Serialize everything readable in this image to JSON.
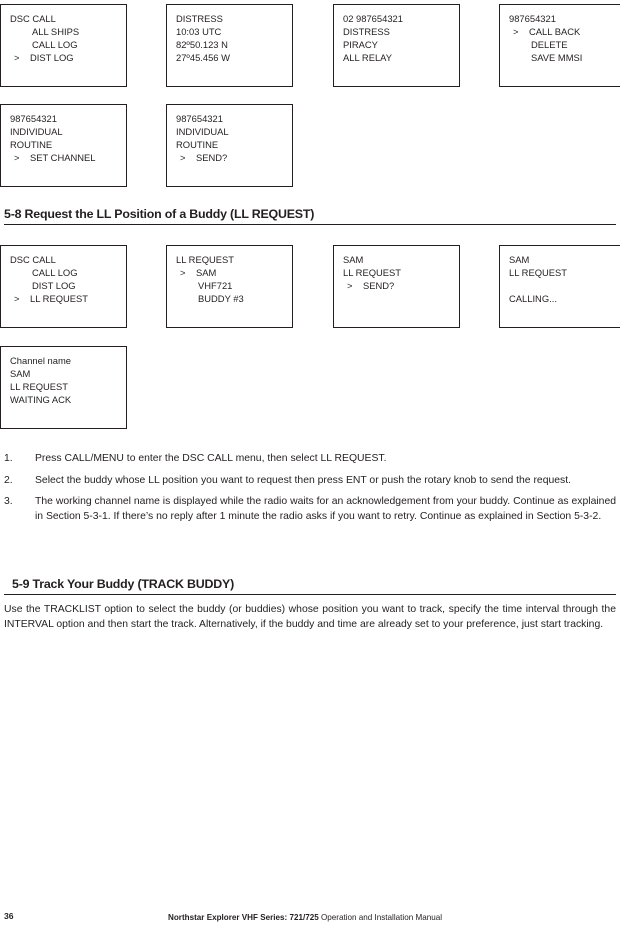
{
  "screens": {
    "row1": [
      {
        "name": "screen-dsc-call-dist-log",
        "lines": [
          {
            "text": "DSC CALL",
            "style": "plain"
          },
          {
            "text": "ALL SHIPS",
            "style": "indent"
          },
          {
            "text": "CALL LOG",
            "style": "indent"
          },
          {
            "text": "DIST LOG",
            "style": "selected"
          }
        ]
      },
      {
        "name": "screen-distress-position",
        "lines": [
          {
            "text": "DISTRESS",
            "style": "plain"
          },
          {
            "text": "10:03 UTC",
            "style": "plain"
          },
          {
            "text": "82º50.123 N",
            "style": "plain"
          },
          {
            "text": "27º45.456 W",
            "style": "plain"
          }
        ]
      },
      {
        "name": "screen-distress-piracy-relay",
        "lines": [
          {
            "text": "02 987654321",
            "style": "plain"
          },
          {
            "text": "DISTRESS",
            "style": "plain"
          },
          {
            "text": "PIRACY",
            "style": "plain"
          },
          {
            "text": "ALL RELAY",
            "style": "plain"
          }
        ]
      },
      {
        "name": "screen-mmsi-options",
        "lines": [
          {
            "text": "987654321",
            "style": "plain"
          },
          {
            "text": "CALL BACK",
            "style": "selected"
          },
          {
            "text": "DELETE",
            "style": "indent"
          },
          {
            "text": "SAVE MMSI",
            "style": "indent"
          }
        ]
      }
    ],
    "row2": [
      {
        "name": "screen-individual-set-channel",
        "lines": [
          {
            "text": "987654321",
            "style": "plain"
          },
          {
            "text": "INDIVIDUAL",
            "style": "plain"
          },
          {
            "text": "ROUTINE",
            "style": "plain"
          },
          {
            "text": "SET CHANNEL",
            "style": "selected"
          }
        ]
      },
      {
        "name": "screen-individual-send",
        "lines": [
          {
            "text": "987654321",
            "style": "plain"
          },
          {
            "text": "INDIVIDUAL",
            "style": "plain"
          },
          {
            "text": "ROUTINE",
            "style": "plain"
          },
          {
            "text": "SEND?",
            "style": "selected"
          }
        ]
      }
    ],
    "row3": [
      {
        "name": "screen-dsc-call-ll-request",
        "lines": [
          {
            "text": "DSC CALL",
            "style": "plain"
          },
          {
            "text": "CALL LOG",
            "style": "indent"
          },
          {
            "text": "DIST LOG",
            "style": "indent"
          },
          {
            "text": "LL REQUEST",
            "style": "selected"
          }
        ]
      },
      {
        "name": "screen-ll-request-buddy-list",
        "lines": [
          {
            "text": "LL REQUEST",
            "style": "plain"
          },
          {
            "text": "SAM",
            "style": "selected"
          },
          {
            "text": "VHF721",
            "style": "indent"
          },
          {
            "text": "BUDDY #3",
            "style": "indent"
          }
        ]
      },
      {
        "name": "screen-sam-ll-request-send",
        "lines": [
          {
            "text": "SAM",
            "style": "plain"
          },
          {
            "text": "LL REQUEST",
            "style": "plain"
          },
          {
            "text": "SEND?",
            "style": "selected"
          }
        ]
      },
      {
        "name": "screen-sam-ll-request-calling",
        "lines": [
          {
            "text": "SAM",
            "style": "plain"
          },
          {
            "text": "LL REQUEST",
            "style": "plain"
          },
          {
            "text": "",
            "style": "plain"
          },
          {
            "text": "CALLING...",
            "style": "plain"
          }
        ]
      }
    ],
    "row4": [
      {
        "name": "screen-channel-name-waiting-ack",
        "lines": [
          {
            "text": "Channel name",
            "style": "plain"
          },
          {
            "text": "SAM",
            "style": "plain"
          },
          {
            "text": "LL REQUEST",
            "style": "plain"
          },
          {
            "text": "WAITING ACK",
            "style": "plain"
          }
        ]
      }
    ]
  },
  "headings": {
    "section_5_8": "5-8 Request the LL Position of a Buddy (LL REQUEST)",
    "section_5_9": "5-9 Track Your Buddy (TRACK BUDDY)"
  },
  "steps": [
    {
      "num": "1.",
      "text": "Press CALL/MENU to enter the DSC CALL menu, then select LL REQUEST."
    },
    {
      "num": "2.",
      "text": "Select the buddy whose LL position you want to request then press ENT or push the rotary knob to send the request."
    },
    {
      "num": "3.",
      "text": "The working channel name is displayed while the radio waits for an acknowledgement from your buddy. Continue as explained in Section 5-3-1. If there’s no reply after 1 minute the radio asks if you want to retry. Continue as explained in Section 5-3-2."
    }
  ],
  "body": {
    "track_buddy_paragraph": "Use the TRACKLIST option to select the buddy (or buddies) whose position you want to track, specify the time interval through the INTERVAL option and then start the track. Alternatively, if the buddy and time are already set to your preference, just start tracking."
  },
  "footer": {
    "page_number": "36",
    "manual_brand": "Northstar",
    "manual_series": "Explorer VHF Series: 721/725",
    "manual_title": " Operation and Installation Manual"
  }
}
